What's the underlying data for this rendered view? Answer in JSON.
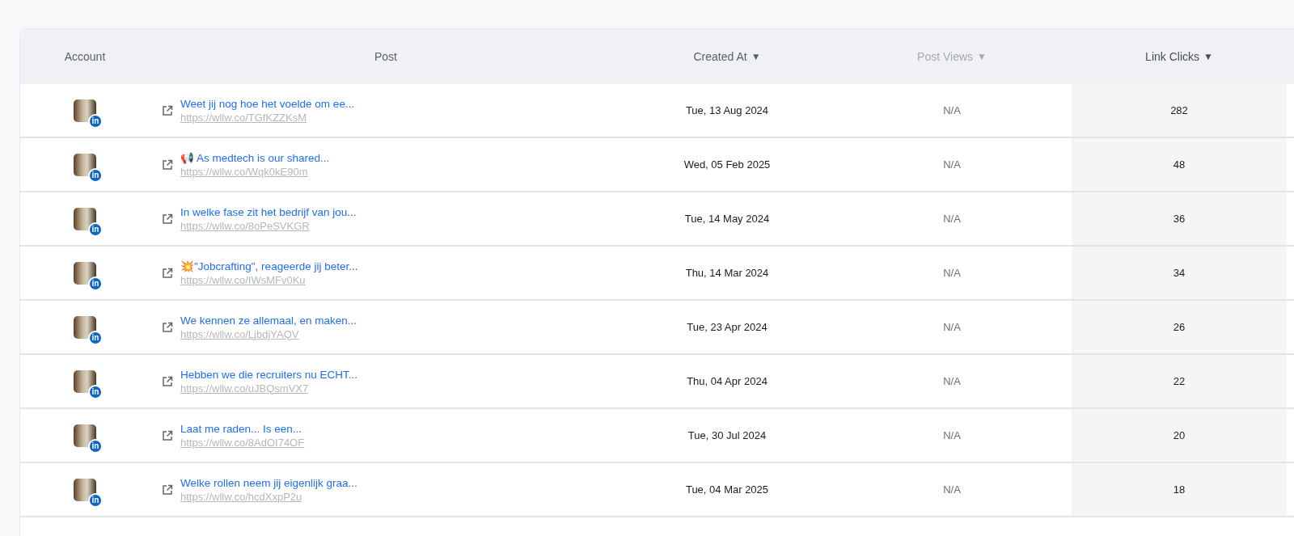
{
  "table": {
    "columns": [
      {
        "label": "Account",
        "sorted": false,
        "disabled": false
      },
      {
        "label": "Post",
        "sorted": false,
        "disabled": false
      },
      {
        "label": "Created At",
        "arrow": "▼",
        "sorted": false,
        "disabled": false
      },
      {
        "label": "Post Views",
        "arrow": "▼",
        "sorted": false,
        "disabled": true
      },
      {
        "label": "Link Clicks",
        "arrow": "▼",
        "sorted": true,
        "disabled": false
      }
    ],
    "rows": [
      {
        "badge": "in",
        "post": "Weet jij nog hoe het voelde om ee...",
        "link": "https://wllw.co/TGfKZZKsM",
        "created": "Tue, 13 Aug 2024",
        "views": "N/A",
        "clicks": "282"
      },
      {
        "badge": "in",
        "post": "📢 As medtech is our shared...",
        "link": "https://wllw.co/Wqk0kE90m",
        "created": "Wed, 05 Feb 2025",
        "views": "N/A",
        "clicks": "48"
      },
      {
        "badge": "in",
        "post": "In welke fase zit het bedrijf van jou...",
        "link": "https://wllw.co/8oPeSVKGR",
        "created": "Tue, 14 May 2024",
        "views": "N/A",
        "clicks": "36"
      },
      {
        "badge": "in",
        "post": "💥\"Jobcrafting\", reageerde jij beter...",
        "link": "https://wllw.co/IWsMFv0Ku",
        "created": "Thu, 14 Mar 2024",
        "views": "N/A",
        "clicks": "34"
      },
      {
        "badge": "in",
        "post": "We kennen ze allemaal, en maken...",
        "link": "https://wllw.co/LjbdjYAQV",
        "created": "Tue, 23 Apr 2024",
        "views": "N/A",
        "clicks": "26"
      },
      {
        "badge": "in",
        "post": "Hebben we die recruiters nu ECHT...",
        "link": "https://wllw.co/uJBQsmVX7",
        "created": "Thu, 04 Apr 2024",
        "views": "N/A",
        "clicks": "22"
      },
      {
        "badge": "in",
        "post": "Laat me raden... Is een...",
        "link": "https://wllw.co/8AdOI74OF",
        "created": "Tue, 30 Jul 2024",
        "views": "N/A",
        "clicks": "20"
      },
      {
        "badge": "in",
        "post": "Welke rollen neem jij eigenlijk graa...",
        "link": "https://wllw.co/hcdXxpP2u",
        "created": "Tue, 04 Mar 2025",
        "views": "N/A",
        "clicks": "18"
      }
    ]
  }
}
